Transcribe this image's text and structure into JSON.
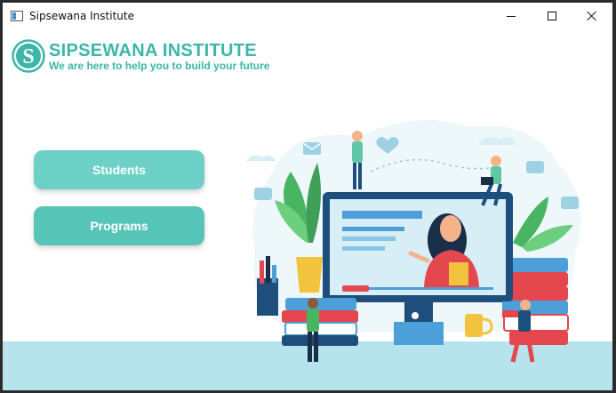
{
  "window": {
    "title": "Sipsewana Institute"
  },
  "brand": {
    "logo_letter": "S",
    "name": "SIPSEWANA INSTITUTE",
    "tagline": "We are here to help you to build your future",
    "accent_color": "#3bb6a9"
  },
  "nav": {
    "students_label": "Students",
    "programs_label": "Programs"
  },
  "icons": {
    "app": "window-app-icon",
    "minimize": "minimize-icon",
    "maximize": "maximize-icon",
    "close": "close-icon"
  }
}
